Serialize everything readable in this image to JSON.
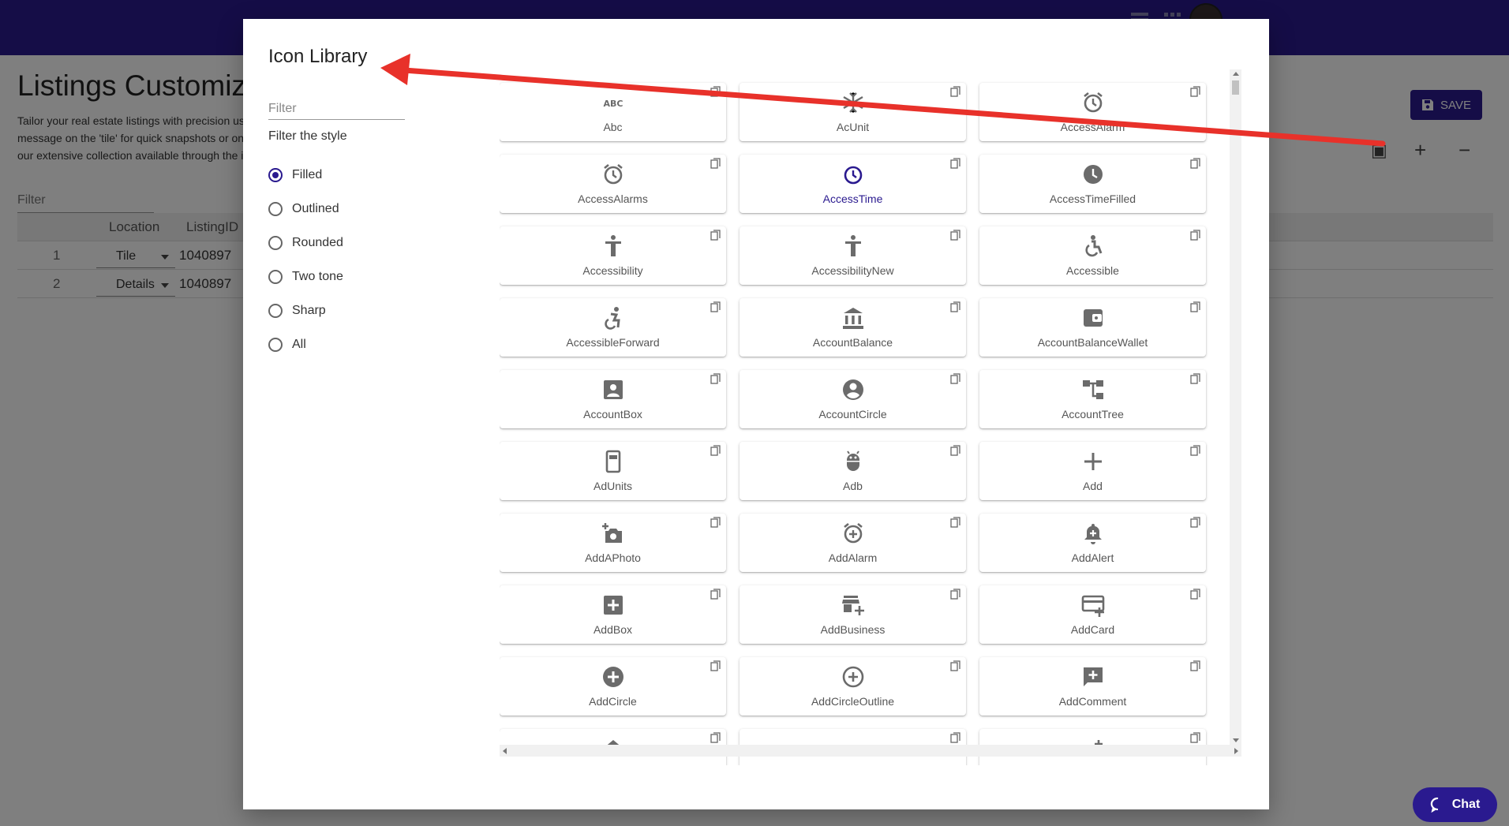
{
  "page": {
    "title": "Listings Customizer",
    "description_lines": [
      "Tailor your real estate listings with precision usi",
      "message on the 'tile' for quick snapshots or on t",
      "our extensive collection available through the i"
    ],
    "save_label": "SAVE",
    "filter_label": "Filter",
    "grid": {
      "columns": [
        "Location",
        "ListingID"
      ],
      "rows": [
        {
          "num": "1",
          "location": "Tile",
          "listing_id": "1040897"
        },
        {
          "num": "2",
          "location": "Details",
          "listing_id": "1040897"
        }
      ]
    },
    "tools": [
      {
        "name": "import-icon",
        "glyph": "▣"
      },
      {
        "name": "plus-icon",
        "glyph": "+"
      },
      {
        "name": "minus-icon",
        "glyph": "−"
      }
    ]
  },
  "modal": {
    "title": "Icon Library",
    "filter_placeholder": "Filter",
    "style_label": "Filter the style",
    "styles": [
      {
        "label": "Filled",
        "checked": true
      },
      {
        "label": "Outlined",
        "checked": false
      },
      {
        "label": "Rounded",
        "checked": false
      },
      {
        "label": "Two tone",
        "checked": false
      },
      {
        "label": "Sharp",
        "checked": false
      },
      {
        "label": "All",
        "checked": false
      }
    ],
    "icons": [
      {
        "label": "Abc",
        "icon": "abc-icon"
      },
      {
        "label": "AcUnit",
        "icon": "ac-unit-icon"
      },
      {
        "label": "AccessAlarm",
        "icon": "access-alarm-icon"
      },
      {
        "label": "AccessAlarms",
        "icon": "access-alarms-icon"
      },
      {
        "label": "AccessTime",
        "icon": "access-time-icon",
        "active": true
      },
      {
        "label": "AccessTimeFilled",
        "icon": "access-time-filled-icon"
      },
      {
        "label": "Accessibility",
        "icon": "accessibility-icon"
      },
      {
        "label": "AccessibilityNew",
        "icon": "accessibility-new-icon"
      },
      {
        "label": "Accessible",
        "icon": "accessible-icon"
      },
      {
        "label": "AccessibleForward",
        "icon": "accessible-forward-icon"
      },
      {
        "label": "AccountBalance",
        "icon": "account-balance-icon"
      },
      {
        "label": "AccountBalanceWallet",
        "icon": "account-balance-wallet-icon"
      },
      {
        "label": "AccountBox",
        "icon": "account-box-icon"
      },
      {
        "label": "AccountCircle",
        "icon": "account-circle-icon"
      },
      {
        "label": "AccountTree",
        "icon": "account-tree-icon"
      },
      {
        "label": "AdUnits",
        "icon": "ad-units-icon"
      },
      {
        "label": "Adb",
        "icon": "adb-icon"
      },
      {
        "label": "Add",
        "icon": "add-icon"
      },
      {
        "label": "AddAPhoto",
        "icon": "add-a-photo-icon"
      },
      {
        "label": "AddAlarm",
        "icon": "add-alarm-icon"
      },
      {
        "label": "AddAlert",
        "icon": "add-alert-icon"
      },
      {
        "label": "AddBox",
        "icon": "add-box-icon"
      },
      {
        "label": "AddBusiness",
        "icon": "add-business-icon"
      },
      {
        "label": "AddCard",
        "icon": "add-card-icon"
      },
      {
        "label": "AddCircle",
        "icon": "add-circle-icon"
      },
      {
        "label": "AddCircleOutline",
        "icon": "add-circle-outline-icon"
      },
      {
        "label": "AddComment",
        "icon": "add-comment-icon"
      },
      {
        "label": "",
        "icon": "add-home-icon"
      },
      {
        "label": "",
        "icon": "add-chart-icon"
      },
      {
        "label": "",
        "icon": "add-ic-call-icon"
      }
    ]
  },
  "chat": {
    "label": "Chat"
  },
  "colors": {
    "brand": "#2a1a8f",
    "icon_gray": "#6b6b6b",
    "annotation": "#e8312a"
  }
}
